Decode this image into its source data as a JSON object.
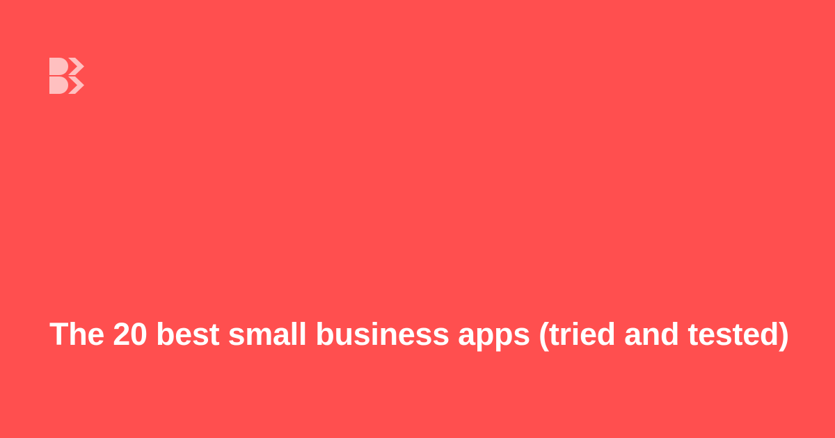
{
  "card": {
    "title": "The 20 best small business apps (tried and tested)",
    "background_color": "#ff4f4f",
    "text_color": "#ffffff",
    "logo": {
      "icon": "brand-logo-icon",
      "color": "#ffc0c0"
    }
  }
}
